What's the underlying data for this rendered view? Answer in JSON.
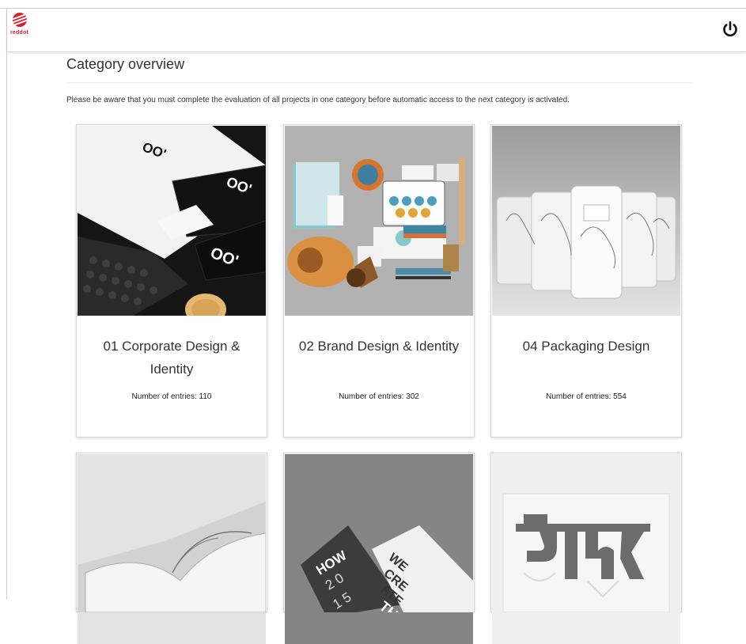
{
  "header": {
    "logo_text": "reddot",
    "brand_color": "#d4202b",
    "power_icon": "power-icon"
  },
  "page": {
    "title": "Category overview",
    "notice": "Please be aware that you must complete the evaluation of all projects in one category before automatic access to the next category is activated."
  },
  "categories": [
    {
      "title": "01 Corporate Design & Identity",
      "entries": "Number of entries: 110",
      "image": "corporate-identity-stationery"
    },
    {
      "title": "02 Brand Design & Identity",
      "entries": "Number of entries: 302",
      "image": "brand-identity-materials"
    },
    {
      "title": "04 Packaging Design",
      "entries": "Number of entries: 554",
      "image": "illustrated-paper-tubes"
    },
    {
      "title": "",
      "entries": "",
      "image": "open-book"
    },
    {
      "title": "",
      "entries": "",
      "image": "typographic-brochures"
    },
    {
      "title": "",
      "entries": "",
      "image": "sculptural-lettering"
    }
  ],
  "thumb_text": {
    "card1": [
      "OO'",
      "OO'",
      "OO'"
    ],
    "card5": [
      "HOW",
      "2 0",
      "1 5",
      "WE",
      "CRE",
      "ATE",
      "THE"
    ]
  }
}
